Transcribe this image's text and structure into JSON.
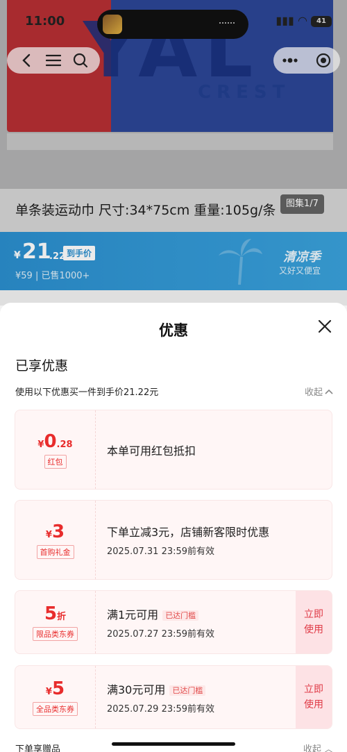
{
  "status_bar": {
    "time": "11:00",
    "battery": "41"
  },
  "hero": {
    "brand_big": "YAL",
    "brand_small": "CREST",
    "gallery_counter": "图集1/7"
  },
  "product": {
    "title": "单条装运动巾 尺寸:34*75cm 重量:105g/条"
  },
  "price": {
    "currency": "¥",
    "integer": "21",
    "decimal": ".22",
    "tag": "到手价",
    "original": "¥59 | 已售1000+",
    "promo_title": "清凉季",
    "promo_sub": "又好又便宜",
    "accent": "#2b8fcf"
  },
  "sheet": {
    "title": "优惠",
    "section_heading": "已享优惠",
    "section_sub": "使用以下优惠买一件到手价21.22元",
    "collapse_label": "收起",
    "coupons": [
      {
        "sym": "¥",
        "big": "0",
        "small": ".28",
        "tag": "红包",
        "desc": "本单可用红包抵扣",
        "valid": "",
        "reached": "",
        "action": ""
      },
      {
        "sym": "¥",
        "big": "3",
        "small": "",
        "tag": "首购礼金",
        "desc": "下单立减3元，店铺新客限时优惠",
        "valid": "2025.07.31 23:59前有效",
        "reached": "",
        "action": ""
      },
      {
        "sym": "",
        "big": "5",
        "small": "折",
        "tag": "限品类东券",
        "desc": "满1元可用",
        "valid": "2025.07.27 23:59前有效",
        "reached": "已达门槛",
        "action_l1": "立即",
        "action_l2": "使用"
      },
      {
        "sym": "¥",
        "big": "5",
        "small": "",
        "tag": "全品类东券",
        "desc": "满30元可用",
        "valid": "2025.07.29 23:59前有效",
        "reached": "已达门槛",
        "action_l1": "立即",
        "action_l2": "使用"
      }
    ],
    "gift_heading": "下单享赠品",
    "gift_collapse": "收起"
  },
  "colors": {
    "coupon_red": "#e82c2c",
    "coupon_bg": "#fff6f6"
  }
}
